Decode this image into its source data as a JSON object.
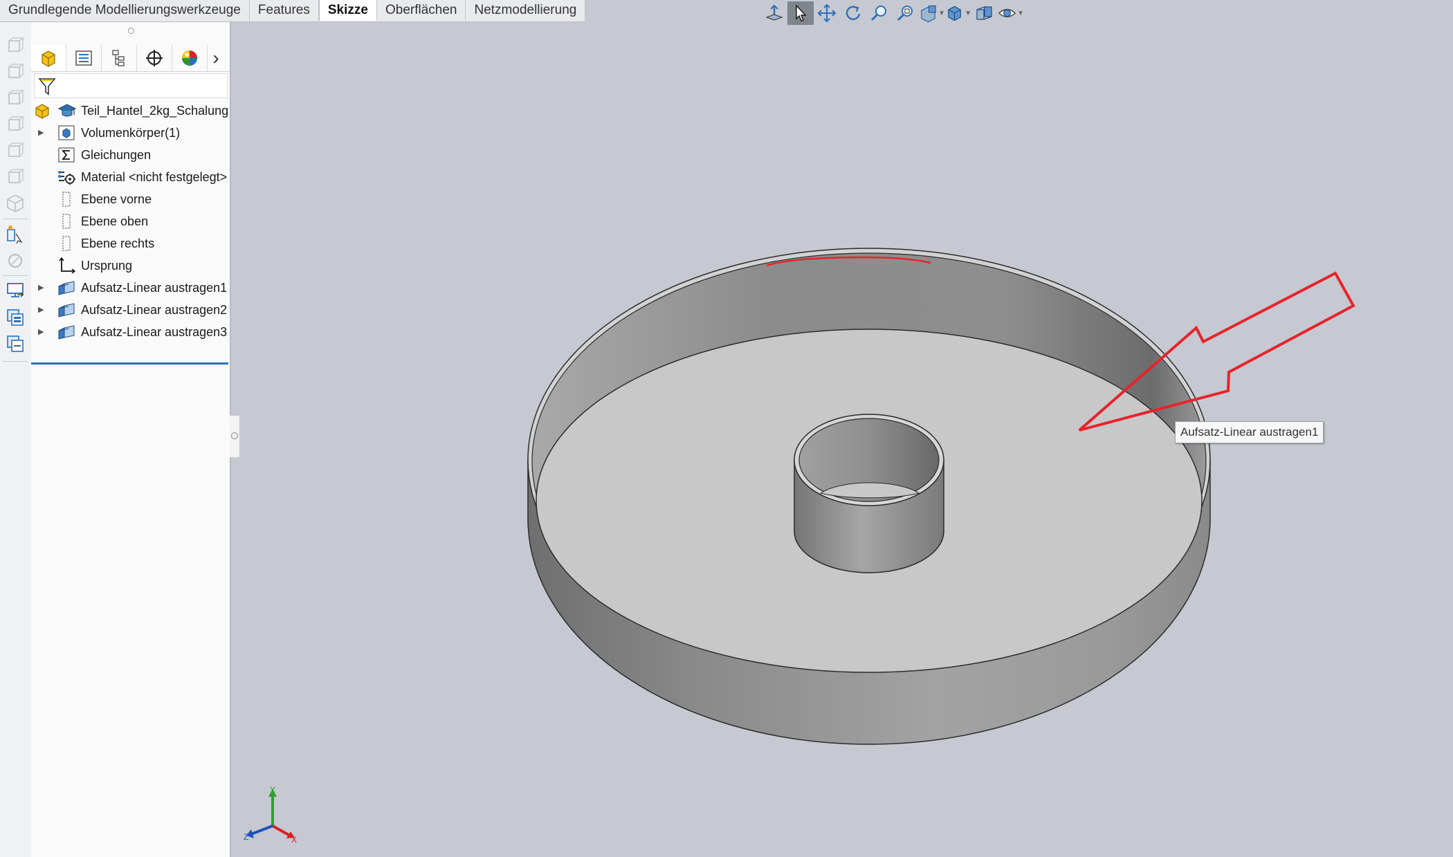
{
  "command_tabs": [
    {
      "label": "Grundlegende Modellierungswerkzeuge"
    },
    {
      "label": "Features"
    },
    {
      "label": "Skizze",
      "active": true
    },
    {
      "label": "Oberflächen"
    },
    {
      "label": "Netzmodellierung"
    }
  ],
  "view_toolbar": {
    "icons": [
      "view-orientation-icon",
      "select-icon",
      "pan-icon",
      "rotate-icon",
      "zoom-to-fit-icon",
      "zoom-to-area-icon",
      "section-view-icon",
      "display-style-icon",
      "view-settings-icon",
      "hide-show-icon"
    ]
  },
  "manager_tabs": [
    "feature-manager-icon",
    "property-manager-icon",
    "configuration-manager-icon",
    "dimxpert-manager-icon",
    "display-manager-icon"
  ],
  "feature_tree": {
    "root": {
      "label": "Teil_Hantel_2kg_Schalung"
    },
    "items": [
      {
        "label": "Volumenkörper(1)",
        "expandable": true,
        "icon": "solid-bodies-icon"
      },
      {
        "label": "Gleichungen",
        "expandable": false,
        "icon": "equations-icon"
      },
      {
        "label": "Material <nicht festgelegt>",
        "expandable": false,
        "icon": "material-icon"
      },
      {
        "label": "Ebene vorne",
        "expandable": false,
        "icon": "plane-icon"
      },
      {
        "label": "Ebene oben",
        "expandable": false,
        "icon": "plane-icon"
      },
      {
        "label": "Ebene rechts",
        "expandable": false,
        "icon": "plane-icon"
      },
      {
        "label": "Ursprung",
        "expandable": false,
        "icon": "origin-icon"
      },
      {
        "label": "Aufsatz-Linear austragen1",
        "expandable": true,
        "icon": "extrude-icon"
      },
      {
        "label": "Aufsatz-Linear austragen2",
        "expandable": true,
        "icon": "extrude-icon"
      },
      {
        "label": "Aufsatz-Linear austragen3",
        "expandable": true,
        "icon": "extrude-icon"
      }
    ]
  },
  "viewport": {
    "tooltip": "Aufsatz-Linear austragen1",
    "triad": {
      "x": "X",
      "y": "Y",
      "z": "Z"
    },
    "colors": {
      "background": "#c6c9d1",
      "annotation": "#e8232c"
    }
  }
}
